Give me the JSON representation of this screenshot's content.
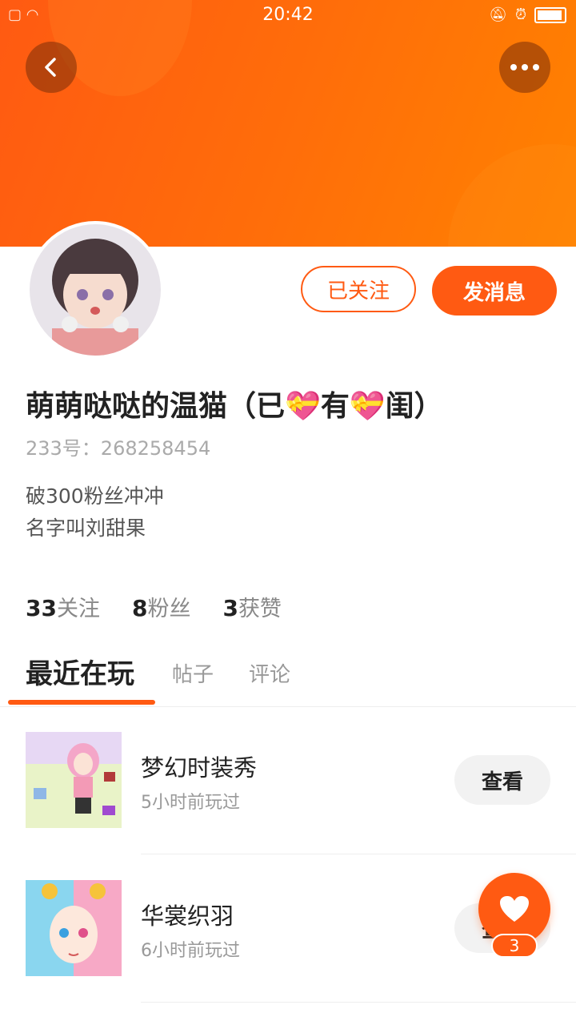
{
  "status_bar": {
    "time": "20:42"
  },
  "header": {
    "back_icon": "chevron-left-icon",
    "more_icon": "more-dots-icon"
  },
  "profile": {
    "username": "萌萌哒哒的温猫（已💝有💝闺）",
    "id_text": "233号：268258454",
    "bio_lines": [
      "破300粉丝冲冲",
      "名字叫刘甜果"
    ],
    "follow_button": "已关注",
    "message_button": "发消息",
    "stats": {
      "following_count": "33",
      "following_label": "关注",
      "fans_count": "8",
      "fans_label": "粉丝",
      "likes_count": "3",
      "likes_label": "获赞"
    }
  },
  "tabs": [
    "最近在玩",
    "帖子",
    "评论"
  ],
  "games": [
    {
      "name": "梦幻时装秀",
      "time": "5小时前玩过",
      "button": "查看"
    },
    {
      "name": "华裳织羽",
      "time": "6小时前玩过",
      "button": "查看"
    }
  ],
  "like_fab": {
    "count": "3",
    "icon": "heart-icon"
  },
  "colors": {
    "accent": "#ff5a12",
    "header_end": "#ff8200"
  }
}
